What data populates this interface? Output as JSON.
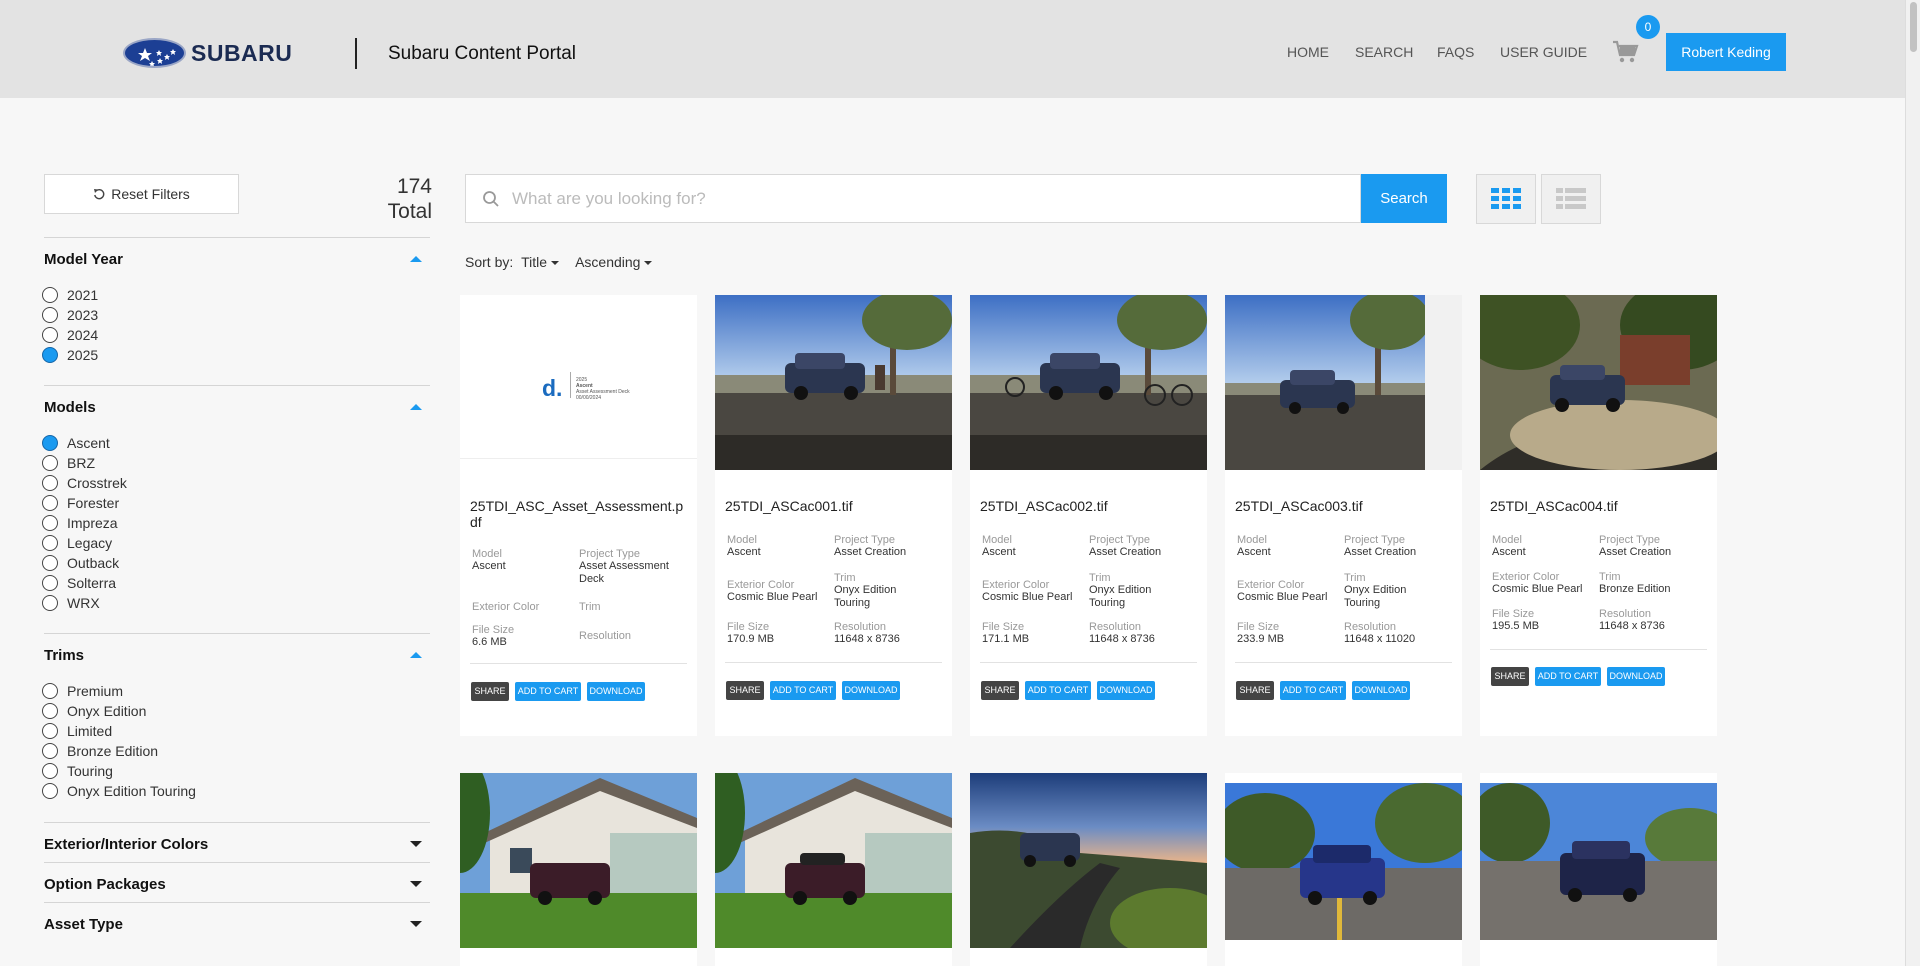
{
  "header": {
    "brand": "SUBARU",
    "portal_title": "Subaru Content Portal",
    "nav": [
      "HOME",
      "SEARCH",
      "FAQS",
      "USER GUIDE"
    ],
    "cart_count": "0",
    "user": "Robert Keding"
  },
  "sidebar": {
    "reset_label": "Reset Filters",
    "total_count": "174",
    "total_label": "Total",
    "model_year": {
      "title": "Model Year",
      "options": [
        "2021",
        "2023",
        "2024",
        "2025"
      ],
      "selected": "2025"
    },
    "models": {
      "title": "Models",
      "options": [
        "Ascent",
        "BRZ",
        "Crosstrek",
        "Forester",
        "Impreza",
        "Legacy",
        "Outback",
        "Solterra",
        "WRX"
      ],
      "selected": "Ascent"
    },
    "trims": {
      "title": "Trims",
      "options": [
        "Premium",
        "Onyx Edition",
        "Limited",
        "Bronze Edition",
        "Touring",
        "Onyx Edition Touring"
      ]
    },
    "collapsed_sections": [
      "Exterior/Interior Colors",
      "Option Packages",
      "Asset Type"
    ]
  },
  "search": {
    "placeholder": "What are you looking for?",
    "button": "Search"
  },
  "sort": {
    "label": "Sort by:",
    "field": "Title",
    "order": "Ascending"
  },
  "labels": {
    "model": "Model",
    "project_type": "Project Type",
    "exterior_color": "Exterior Color",
    "trim": "Trim",
    "file_size": "File Size",
    "resolution": "Resolution",
    "share": "SHARE",
    "add_to_cart": "ADD TO CART",
    "download": "DOWNLOAD"
  },
  "cards": [
    {
      "title": "25TDI_ASC_Asset_Assessment.pdf",
      "model": "Ascent",
      "project_type": "Asset Assessment Deck",
      "exterior_color": "",
      "trim": "",
      "file_size": "6.6 MB",
      "resolution": "",
      "pdf_logo": "d.",
      "pdf_text": [
        "2025",
        "Ascent",
        "Asset Assessment Deck",
        "00/00/2024"
      ]
    },
    {
      "title": "25TDI_ASCac001.tif",
      "model": "Ascent",
      "project_type": "Asset Creation",
      "exterior_color": "Cosmic Blue Pearl",
      "trim": "Onyx Edition Touring",
      "file_size": "170.9 MB",
      "resolution": "11648 x 8736"
    },
    {
      "title": "25TDI_ASCac002.tif",
      "model": "Ascent",
      "project_type": "Asset Creation",
      "exterior_color": "Cosmic Blue Pearl",
      "trim": "Onyx Edition Touring",
      "file_size": "171.1 MB",
      "resolution": "11648 x 8736"
    },
    {
      "title": "25TDI_ASCac003.tif",
      "model": "Ascent",
      "project_type": "Asset Creation",
      "exterior_color": "Cosmic Blue Pearl",
      "trim": "Onyx Edition Touring",
      "file_size": "233.9 MB",
      "resolution": "11648 x 11020"
    },
    {
      "title": "25TDI_ASCac004.tif",
      "model": "Ascent",
      "project_type": "Asset Creation",
      "exterior_color": "Cosmic Blue Pearl",
      "trim": "Bronze Edition",
      "file_size": "195.5 MB",
      "resolution": "11648 x 8736"
    }
  ],
  "colors": {
    "accent": "#1a9af0",
    "header_bg": "#e3e3e3",
    "page_bg": "#f7f7f7",
    "share_btn": "#444444"
  }
}
